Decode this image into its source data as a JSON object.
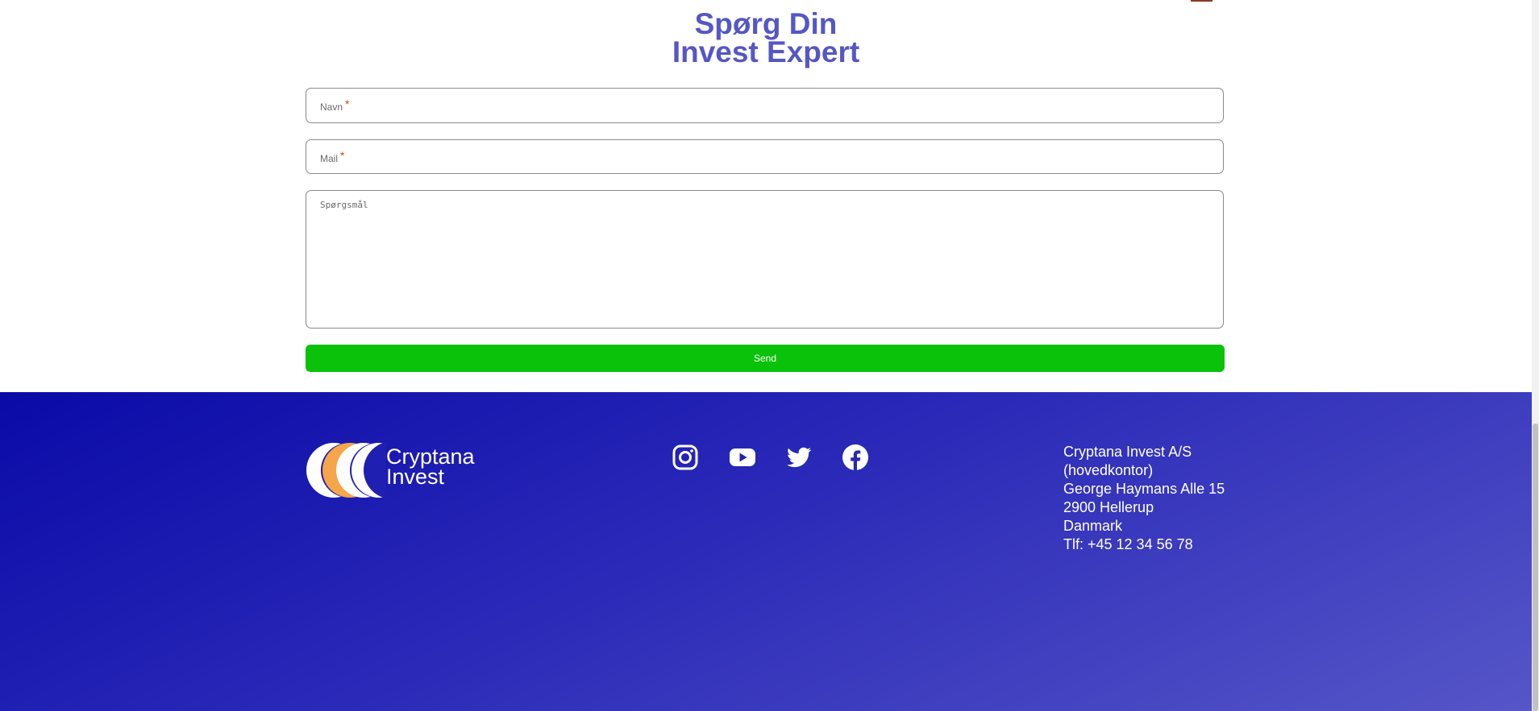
{
  "form": {
    "title_line1": "Spørg Din",
    "title_line2": "Invest Expert",
    "name_label": "Navn",
    "mail_label": "Mail",
    "required_mark": "*",
    "question_placeholder": "Spørgsmål",
    "send_label": "Send"
  },
  "footer": {
    "logo": {
      "line1": "Cryptana",
      "line2": "Invest"
    },
    "social": [
      {
        "icon": "instagram-icon"
      },
      {
        "icon": "youtube-icon"
      },
      {
        "icon": "twitter-icon"
      },
      {
        "icon": "facebook-icon"
      }
    ],
    "address": {
      "line1": "Cryptana Invest A/S",
      "line2": "(hovedkontor)",
      "line3": "George Haymans Alle 15",
      "line4": "2900 Hellerup",
      "line5": "Danmark",
      "line6": "Tlf: +45 12 34 56 78"
    }
  },
  "colors": {
    "title": "#5557c4",
    "send_button": "#0bc20b",
    "footer_start": "#0a0aa8",
    "footer_end": "#5656c8",
    "logo_orange": "#f5a54a"
  }
}
